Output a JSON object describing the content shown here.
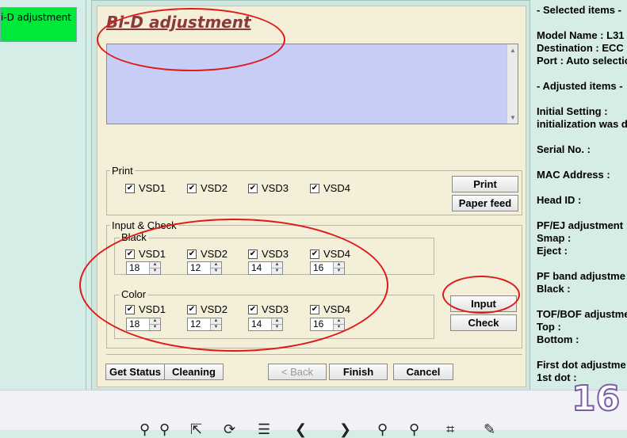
{
  "nav": {
    "active_item": "i-D adjustment"
  },
  "dialog": {
    "title": "Bi-D adjustment",
    "memo_text": "",
    "print_group": {
      "label": "Print",
      "checks": [
        {
          "label": "VSD1",
          "checked": true
        },
        {
          "label": "VSD2",
          "checked": true
        },
        {
          "label": "VSD3",
          "checked": true
        },
        {
          "label": "VSD4",
          "checked": true
        }
      ],
      "print_button": "Print",
      "paper_feed_button": "Paper feed"
    },
    "input_check_group": {
      "label": "Input & Check",
      "black": {
        "label": "Black",
        "checks": [
          {
            "label": "VSD1",
            "checked": true,
            "value": "18"
          },
          {
            "label": "VSD2",
            "checked": true,
            "value": "12"
          },
          {
            "label": "VSD3",
            "checked": true,
            "value": "14"
          },
          {
            "label": "VSD4",
            "checked": true,
            "value": "16"
          }
        ]
      },
      "color": {
        "label": "Color",
        "checks": [
          {
            "label": "VSD1",
            "checked": true,
            "value": "18"
          },
          {
            "label": "VSD2",
            "checked": true,
            "value": "12"
          },
          {
            "label": "VSD3",
            "checked": true,
            "value": "14"
          },
          {
            "label": "VSD4",
            "checked": true,
            "value": "16"
          }
        ]
      },
      "input_button": "Input",
      "check_button": "Check"
    },
    "footer": {
      "get_status": "Get Status",
      "cleaning": "Cleaning",
      "back": "< Back",
      "finish": "Finish",
      "cancel": "Cancel"
    }
  },
  "right_panel": {
    "lines": [
      "- Selected items -",
      "Model Name : L31",
      "Destination : ECC",
      "Port : Auto selectio",
      "- Adjusted items -",
      "Initial Setting :",
      "initialization was d",
      "Serial No. :",
      "MAC Address :",
      "Head ID :",
      "PF/EJ adjustment",
      " Smap :",
      " Eject :",
      "PF band adjustme",
      " Black :",
      "TOF/BOF adjustme",
      " Top :",
      " Bottom :",
      "First dot adjustme",
      " 1st dot :"
    ]
  },
  "page_number": "16",
  "colors": {
    "annotation": "#e01818",
    "title": "#8b3a3a",
    "memo_bg": "#c8cdf6",
    "nav_active": "#00e83a"
  }
}
